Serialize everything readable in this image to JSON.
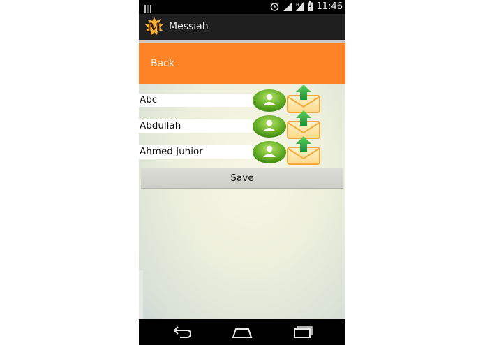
{
  "status_bar": {
    "time": "11:46",
    "icons": [
      "notification-icon",
      "alarm-icon",
      "wifi-icon",
      "signal-icon",
      "battery-icon"
    ]
  },
  "app": {
    "title": "Messiah",
    "logo_letter": "M",
    "logo_color": "#f5a623"
  },
  "header": {
    "back_label": "Back",
    "banner_color": "#fe8326"
  },
  "contacts": [
    {
      "name": "Abc",
      "contact_icon": "contact-person-icon",
      "action_icon": "email-upload-icon"
    },
    {
      "name": "Abdullah",
      "contact_icon": "contact-person-icon",
      "action_icon": "email-upload-icon"
    },
    {
      "name": "Ahmed Junior",
      "contact_icon": "contact-person-icon",
      "action_icon": "email-upload-icon"
    }
  ],
  "save_label": "Save",
  "nav_bar": {
    "buttons": [
      "back-nav-icon",
      "home-nav-icon",
      "recent-apps-icon"
    ]
  }
}
